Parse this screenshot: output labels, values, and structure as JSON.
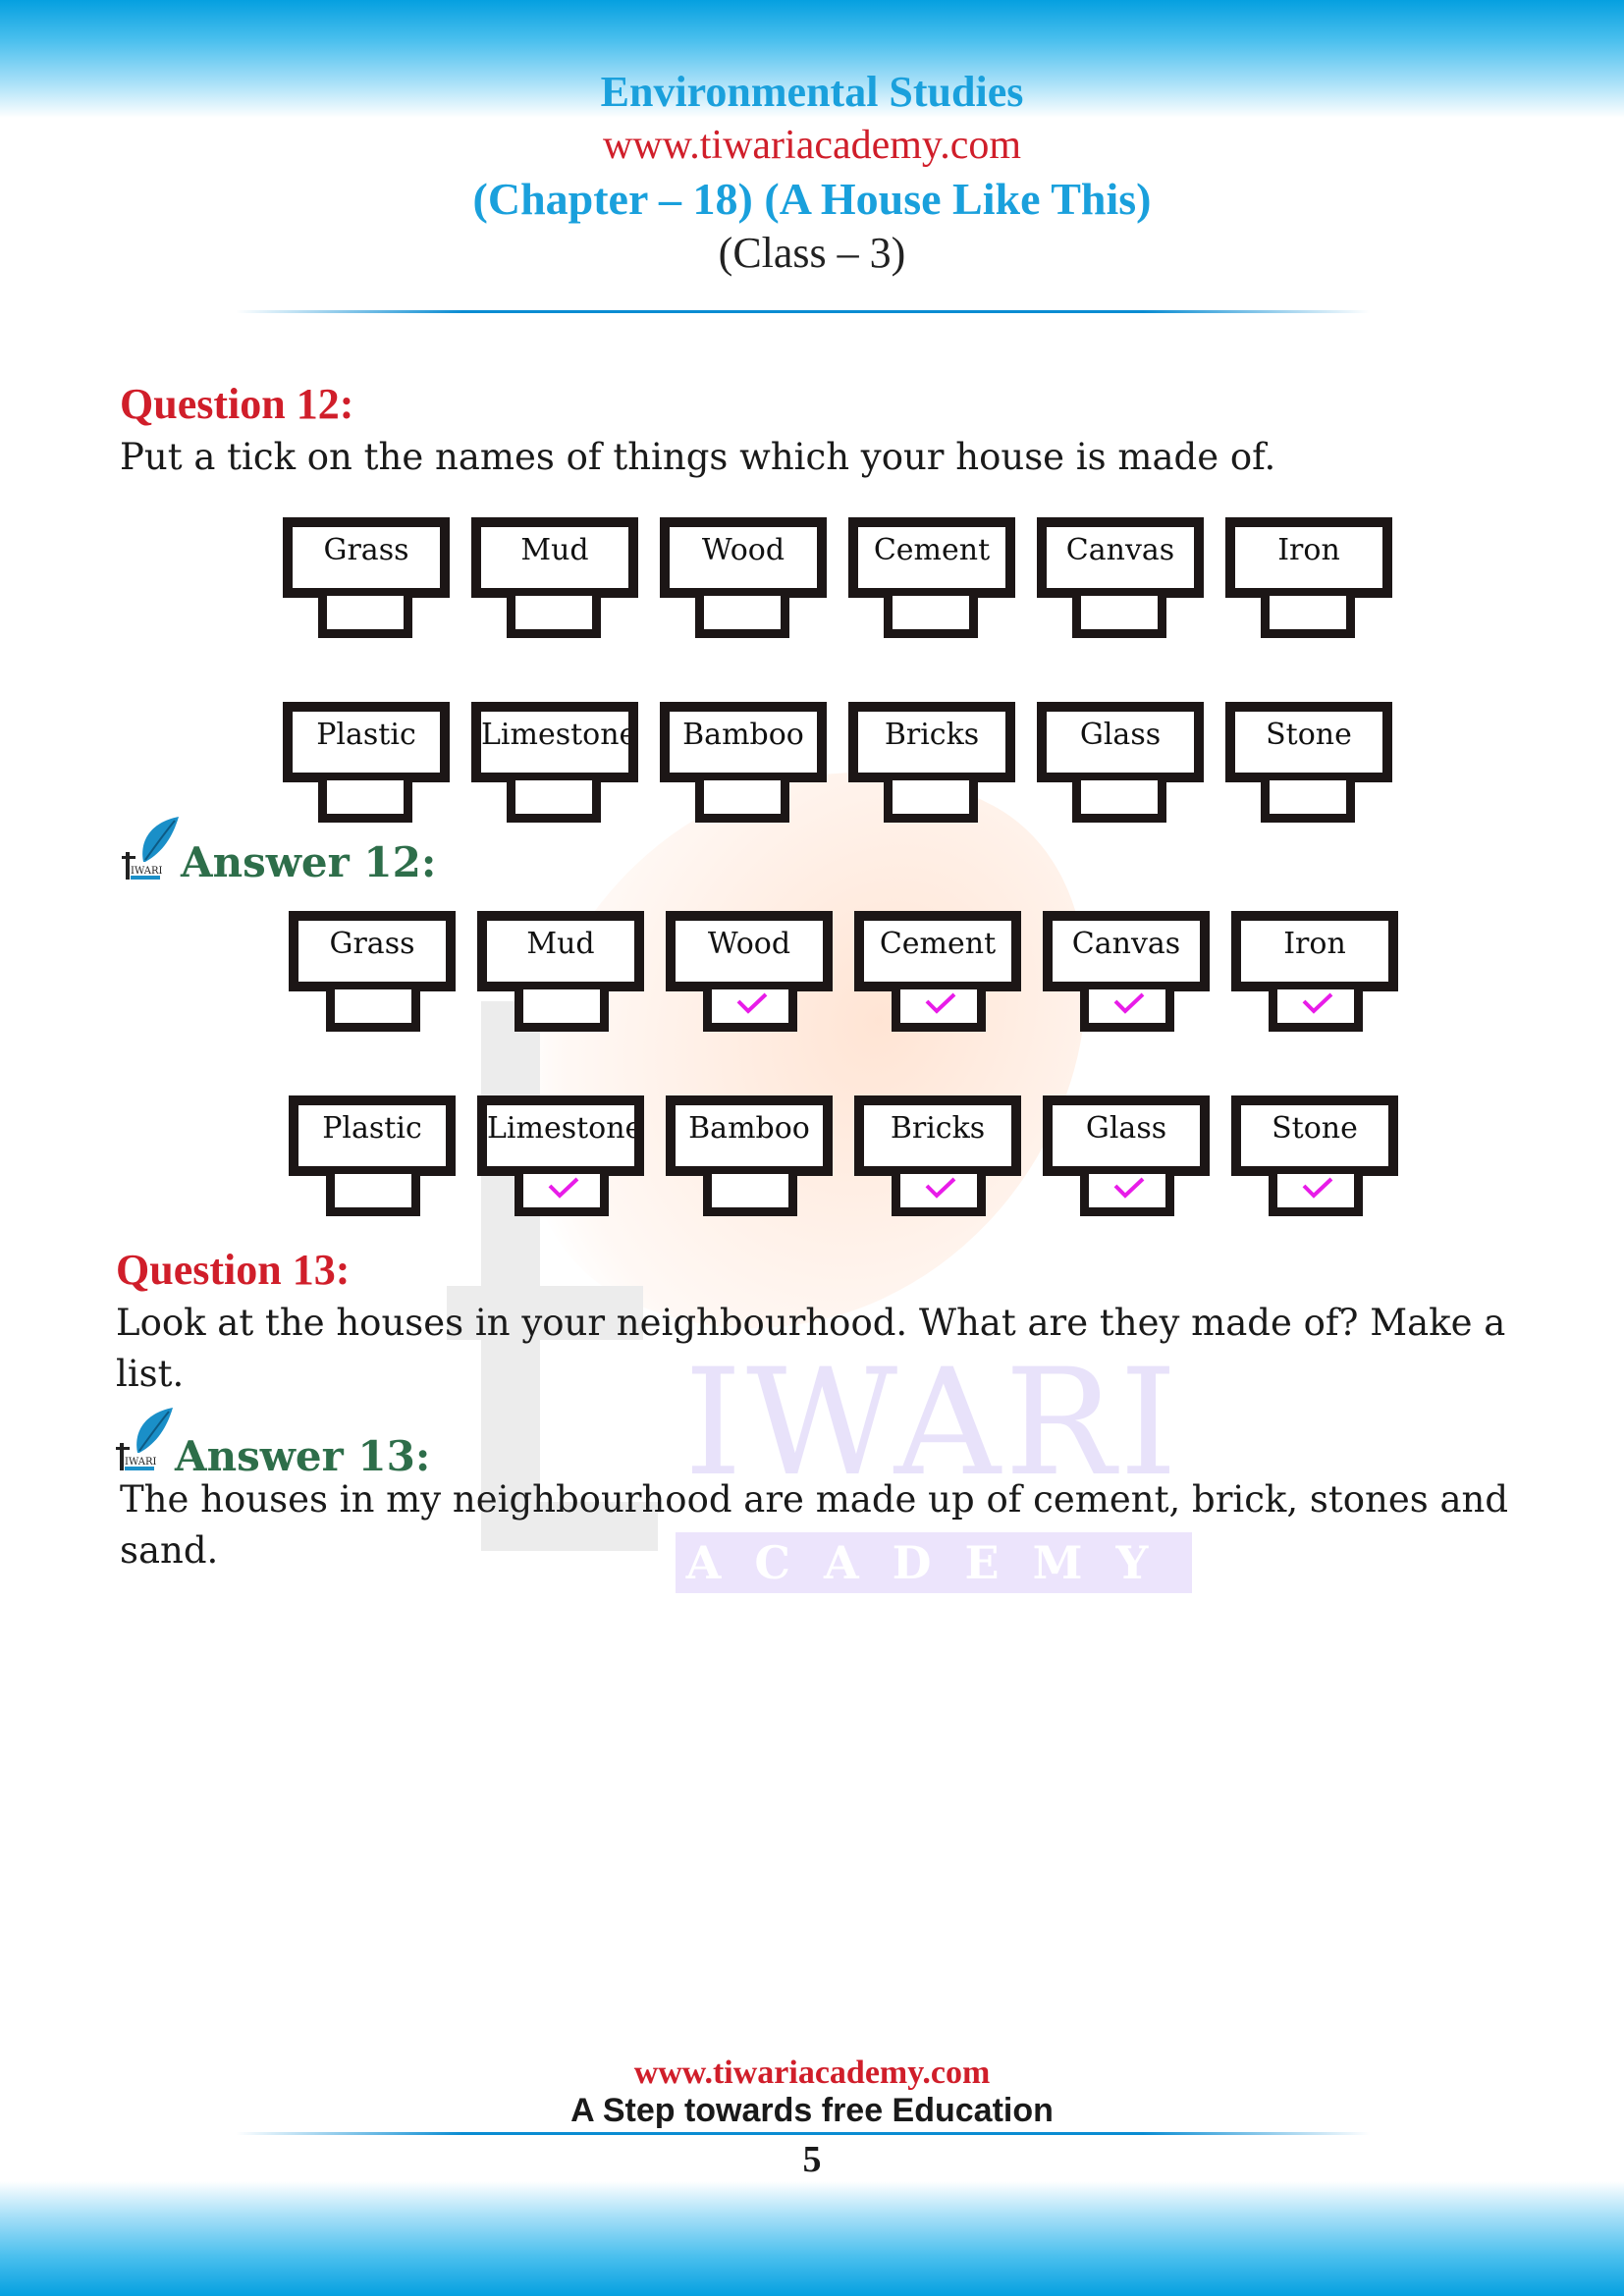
{
  "header": {
    "subject": "Environmental Studies",
    "website": "www.tiwariacademy.com",
    "chapter": "(Chapter – 18) (A House Like This)",
    "class": "(Class – 3)"
  },
  "watermark": {
    "word": "IWARI",
    "subword": "ACADEMY"
  },
  "logo": {
    "text": "IWARI",
    "icon": "tiwari-academy-leaf-logo"
  },
  "question12": {
    "heading": "Question 12:",
    "text": "Put a tick on the names of things which your house is made of.",
    "rows": [
      [
        {
          "label": "Grass"
        },
        {
          "label": "Mud"
        },
        {
          "label": "Wood"
        },
        {
          "label": "Cement"
        },
        {
          "label": "Canvas"
        },
        {
          "label": "Iron"
        }
      ],
      [
        {
          "label": "Plastic"
        },
        {
          "label": "Limestone"
        },
        {
          "label": "Bamboo"
        },
        {
          "label": "Bricks"
        },
        {
          "label": "Glass"
        },
        {
          "label": "Stone"
        }
      ]
    ]
  },
  "answer12": {
    "heading": "Answer 12:",
    "tick_color": "#e81ce8",
    "rows": [
      [
        {
          "label": "Grass",
          "checked": false
        },
        {
          "label": "Mud",
          "checked": false
        },
        {
          "label": "Wood",
          "checked": true
        },
        {
          "label": "Cement",
          "checked": true
        },
        {
          "label": "Canvas",
          "checked": true
        },
        {
          "label": "Iron",
          "checked": true
        }
      ],
      [
        {
          "label": "Plastic",
          "checked": false
        },
        {
          "label": "Limestone",
          "checked": true
        },
        {
          "label": "Bamboo",
          "checked": false
        },
        {
          "label": "Bricks",
          "checked": true
        },
        {
          "label": "Glass",
          "checked": true
        },
        {
          "label": "Stone",
          "checked": true
        }
      ]
    ]
  },
  "question13": {
    "heading": "Question 13:",
    "text_line1": "Look at the houses in your neighbourhood. What are they made of? Make a",
    "text_line2": "list."
  },
  "answer13": {
    "heading": "Answer 13:",
    "text_line1": "The houses in my neighbourhood are made up of cement, brick, stones and",
    "text_line2": "sand."
  },
  "footer": {
    "website": "www.tiwariacademy.com",
    "tagline": "A Step towards free Education",
    "page_number": "5"
  }
}
